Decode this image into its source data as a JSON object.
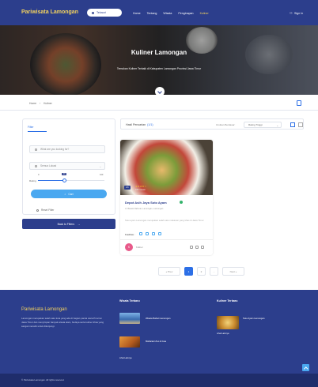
{
  "header": {
    "brand": "Pariwisata Lamongan",
    "search_pill": "Telusuri",
    "nav": [
      "Home",
      "Tentang",
      "Wisata",
      "Penginapan",
      "Kuliner"
    ],
    "active_nav_index": 4,
    "signin": "Sign In"
  },
  "hero": {
    "title": "Kuliner Lamongan",
    "subtitle": "Temukan Kuliner Terbaik di Kabupaten Lamongan Provinsi Jawa Timur"
  },
  "breadcrumb": {
    "items": [
      "Home",
      "Kuliner"
    ]
  },
  "filter": {
    "tab_label": "Filter",
    "search_placeholder": "What are you looking for?",
    "category_select": "Semua Lokasi",
    "slider_label": "Rating",
    "slider_min": "0",
    "slider_max": "100",
    "slider_value": "40",
    "slider_value_fraction": 0.4,
    "search_button": "Cari",
    "reset_label": "Reset Filter",
    "back_button": "Back to Filters"
  },
  "results": {
    "title": "Hasil Pencarian",
    "count": "(1/1)",
    "sort_label": "Urutkan Berdasar:",
    "sort_value": "Rating Tinggi"
  },
  "card": {
    "badge": "4.6",
    "stars": "★★★★☆",
    "reviews": "100 reviews",
    "name": "Depot Asih Jaya Soto Ayam",
    "address": "Jl. Basuki Rahmat, Lamongan, Lamongan",
    "description": "Soto ayam Lamongan merupakan salah satu makanan yang khas di Jawa Timur.",
    "facilities_label": "Fasilitas :",
    "author": "Kuliner"
  },
  "pagination": {
    "prev": "« Prev",
    "pages": [
      "1",
      "2",
      "…"
    ],
    "next": "Next »",
    "active_index": 0
  },
  "footer": {
    "brand": "Pariwisata Lamongan",
    "description": "Lamongan merupakan salah satu kota yang ada di bagian pantai utara Provinsi Jawa Timur dan menyimpan banyak wisata alam, budaya serta kuliner khas yang sangat menarik untuk dikunjungi.",
    "col1_title": "Wisata Terbaru",
    "col1_items": [
      "Wisata Bahari Lamongan",
      "Maharani Zoo & Goa"
    ],
    "col1_link": "Lihat Lainnya",
    "col2_title": "Kuliner Terbaru",
    "col2_items": [
      "Soto Ayam Lamongan"
    ],
    "col2_link": "Lihat Lainnya",
    "copyright": "© Pariwisata Lamongan. All rights reserved."
  },
  "colors": {
    "primary": "#2c3e8c",
    "accent": "#f4d35e",
    "blue": "#2c6fe6",
    "light_blue": "#4aa8f0"
  }
}
